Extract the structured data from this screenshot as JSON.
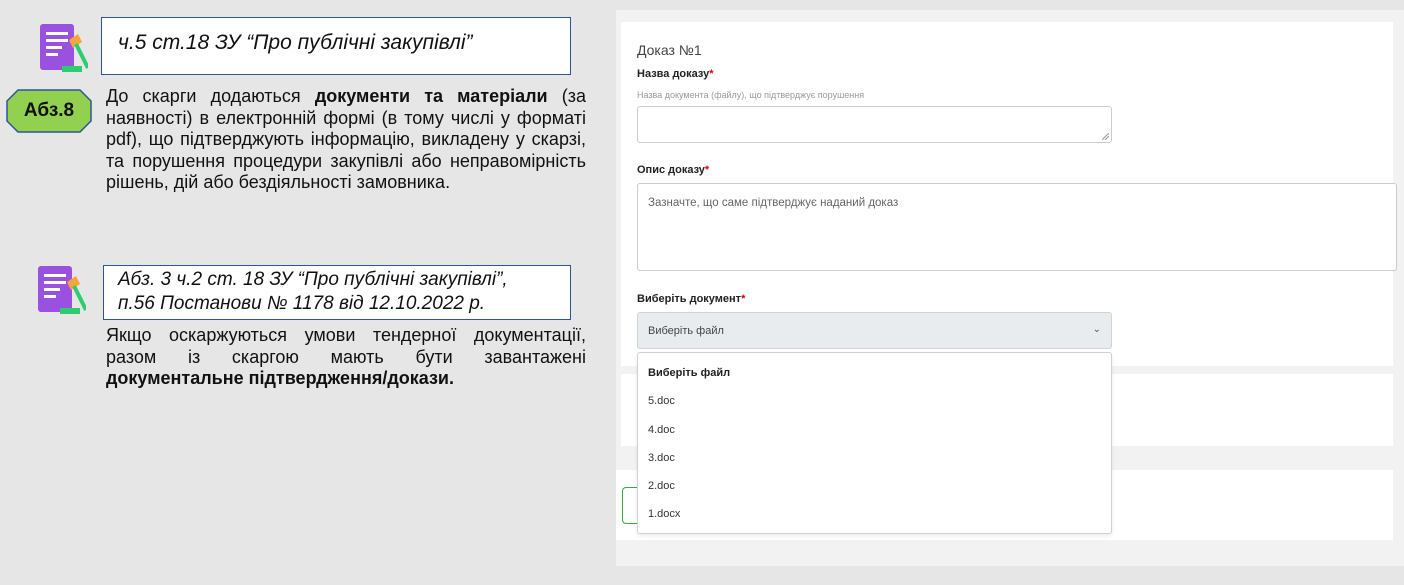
{
  "slide": {
    "ref1": "ч.5 ст.18 ЗУ “Про публічні закупівлі”",
    "badge": "Абз.8",
    "para1": {
      "t1": "До скарги додаються ",
      "b1": "документи та матеріали",
      "t2": " (за наявності) в електронній формі (в тому числі у форматі pdf), що підтверджують інформацію, викладену у скарзі, та порушення процедури закупівлі або неправомірність рішень, дій або бездіяльності замовника."
    },
    "ref2_line1": "Абз. 3 ч.2 ст. 18 ЗУ “Про публічні закупівлі”,",
    "ref2_line2": "п.56 Постанови № 1178 від 12.10.2022 р.",
    "para2": {
      "t1": "Якщо оскаржуються умови тендерної документації, разом із скаргою мають бути завантажені ",
      "b1": "документальне підтвердження/докази."
    }
  },
  "form": {
    "proof_title": "Доказ №1",
    "name_label": "Назва доказу",
    "name_hint": "Назва документа (файлу), що підтверджує порушення",
    "name_value": "",
    "desc_label": "Опис доказу",
    "desc_placeholder": "Зазначте, що саме підтверджує наданий доказ",
    "doc_label": "Виберіть документ",
    "required_mark": "*",
    "select_value": "Виберіть файл",
    "options": [
      "Виберіть файл",
      "5.doc",
      "4.doc",
      "3.doc",
      "2.doc",
      "1.docx"
    ]
  },
  "colors": {
    "ref_border": "#2f5597",
    "badge_fill": "#92d050",
    "badge_border": "#2f5597",
    "icon_purple": "#9b51e0",
    "required": "#d0021b"
  },
  "icons": {
    "legal_icon": "document-with-gavel-icon",
    "chevron": "chevron-down-icon"
  }
}
